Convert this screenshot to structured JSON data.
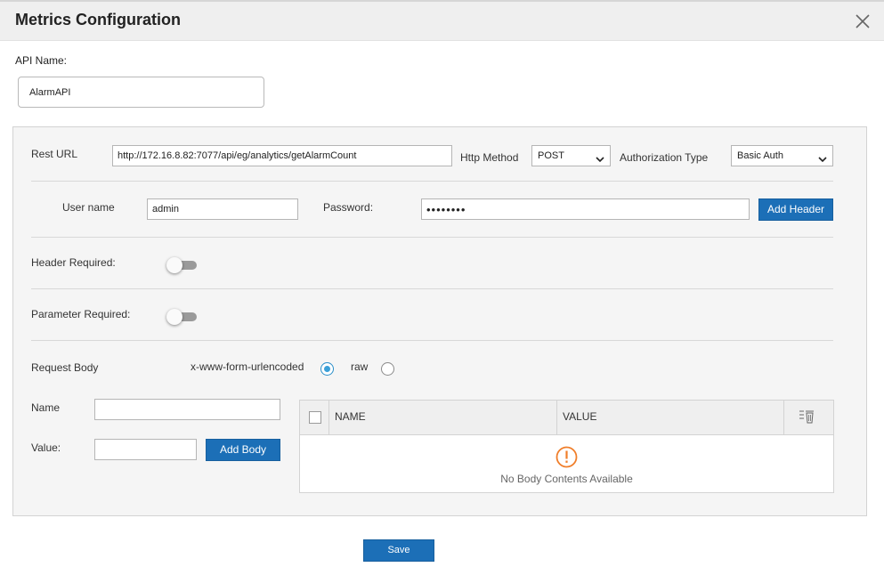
{
  "dialog": {
    "title": "Metrics Configuration"
  },
  "api": {
    "label": "API Name:",
    "value": "AlarmAPI"
  },
  "rest": {
    "label": "Rest URL",
    "url": "http://172.16.8.82:7077/api/eg/analytics/getAlarmCount",
    "method_label": "Http Method",
    "method_value": "POST",
    "auth_label": "Authorization Type",
    "auth_value": "Basic Auth"
  },
  "auth": {
    "user_label": "User name",
    "user_value": "admin",
    "password_label": "Password:",
    "password_value": "••••••••",
    "add_header_label": "Add Header"
  },
  "toggles": {
    "header_label": "Header Required:",
    "header_on": false,
    "param_label": "Parameter Required:",
    "param_on": false
  },
  "body": {
    "label": "Request Body",
    "option_form": "x-www-form-urlencoded",
    "option_raw": "raw",
    "selected": "x-www-form-urlencoded",
    "name_label": "Name",
    "name_value": "",
    "value_label": "Value:",
    "value_value": "",
    "add_body_label": "Add Body"
  },
  "grid": {
    "columns": [
      "NAME",
      "VALUE"
    ],
    "empty_message": "No Body Contents Available"
  },
  "footer": {
    "save_label": "Save"
  },
  "colors": {
    "accent": "#1c6fb7",
    "warning": "#f07e2a",
    "radio_selected": "#3ba0d8"
  },
  "icons": {
    "close": "close-icon",
    "chevron": "chevron-down-icon",
    "delete_all": "delete-all-icon",
    "warning": "warning-circle-icon"
  }
}
